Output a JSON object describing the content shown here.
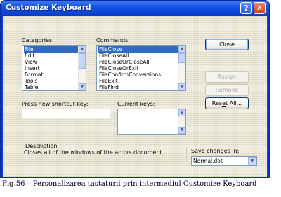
{
  "window": {
    "title": "Customize Keyboard",
    "help_glyph": "?",
    "close_glyph": "✕"
  },
  "categories": {
    "label_pre": "",
    "label_acc": "C",
    "label_post": "ategories:",
    "items": [
      "File",
      "Edit",
      "View",
      "Insert",
      "Format",
      "Tools",
      "Table"
    ],
    "selected_index": 0
  },
  "commands": {
    "label_pre": "C",
    "label_acc": "o",
    "label_post": "mmands:",
    "items": [
      "FileClose",
      "FileCloseAll",
      "FileCloseOrCloseAll",
      "FileCloseOrExit",
      "FileConfirmConversions",
      "FileExit",
      "FileFind"
    ],
    "selected_index": 0
  },
  "shortcut": {
    "label_pre": "Press ",
    "label_acc": "n",
    "label_post": "ew shortcut key:",
    "value": ""
  },
  "current_keys": {
    "label_pre": "C",
    "label_acc": "u",
    "label_post": "rrent keys:"
  },
  "buttons": {
    "close": "Close",
    "assign": "Assign",
    "remove": "Remove",
    "reset_pre": "Res",
    "reset_acc": "e",
    "reset_post": "t All..."
  },
  "description": {
    "legend": "Description",
    "text": "Closes all of the windows of the active document"
  },
  "save_changes": {
    "label_pre": "Sa",
    "label_acc": "v",
    "label_post": "e changes in:",
    "value": "Normal.dot"
  },
  "scroll_glyphs": {
    "up": "▲",
    "down": "▼"
  },
  "caption": "Fig.56 – Personalizarea tastaturii prin intermediul Customize Keyboard",
  "colors": {
    "title_bar": "#0b44d4",
    "selection": "#316ac5",
    "dialog_face": "#ece9d8"
  }
}
